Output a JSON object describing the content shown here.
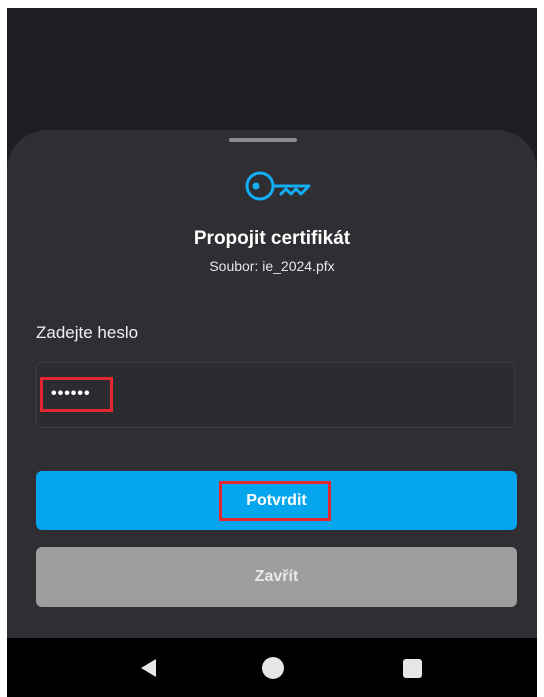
{
  "dialog": {
    "icon": "key-icon",
    "title": "Propojit certifikát",
    "subtitle": "Soubor: ie_2024.pfx"
  },
  "password": {
    "label": "Zadejte heslo",
    "value": "••••••"
  },
  "buttons": {
    "confirm_label": "Potvrdit",
    "close_label": "Zavřít"
  },
  "navigation": {
    "back_icon": "back-triangle-icon",
    "home_icon": "home-circle-icon",
    "recents_icon": "recents-square-icon"
  },
  "colors": {
    "background": "#1e1e22",
    "sheet": "#2e2e33",
    "accent": "#06a6ee",
    "secondary_button": "#9e9e9e",
    "highlight": "#e3262f"
  }
}
